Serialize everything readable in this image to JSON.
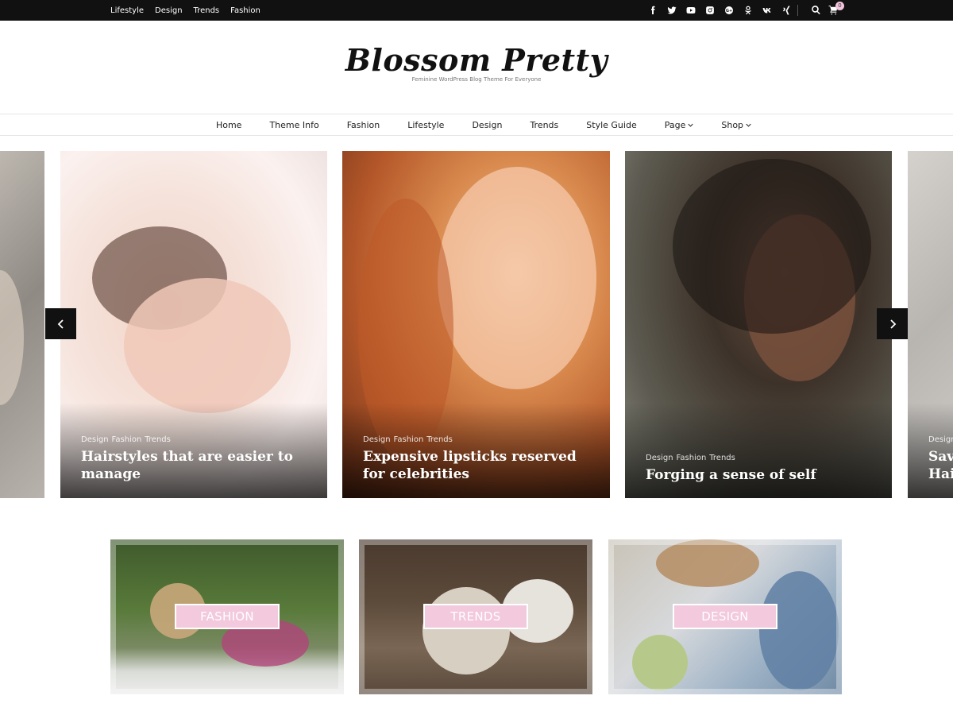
{
  "topbar": {
    "nav": [
      "Lifestyle",
      "Design",
      "Trends",
      "Fashion"
    ],
    "social_icons": [
      "facebook-icon",
      "twitter-icon",
      "youtube-icon",
      "instagram-icon",
      "google-plus-icon",
      "odnoklassniki-icon",
      "vk-icon",
      "xing-icon"
    ],
    "cart_count": "0"
  },
  "brand": {
    "title": "Blossom Pretty",
    "tagline": "Feminine WordPress Blog Theme For Everyone"
  },
  "mainnav": {
    "items": [
      {
        "label": "Home"
      },
      {
        "label": "Theme Info"
      },
      {
        "label": "Fashion"
      },
      {
        "label": "Lifestyle"
      },
      {
        "label": "Design"
      },
      {
        "label": "Trends"
      },
      {
        "label": "Style Guide"
      },
      {
        "label": "Page"
      },
      {
        "label": "Shop"
      }
    ]
  },
  "slider": {
    "slides": [
      {
        "categories": [
          "Design",
          "Fashion",
          "Trends"
        ],
        "title": "Hairstyles that are easier to manage"
      },
      {
        "categories": [
          "Design",
          "Fashion",
          "Trends"
        ],
        "title": "Expensive lipsticks reserved for celebrities"
      },
      {
        "categories": [
          "Design",
          "Fashion",
          "Trends"
        ],
        "title": "Forging a sense of self"
      }
    ],
    "edge_right": {
      "category": "Design",
      "title_line1": "Save",
      "title_line2": "Hair"
    }
  },
  "categories": [
    {
      "label": "FASHION"
    },
    {
      "label": "TRENDS"
    },
    {
      "label": "DESIGN"
    }
  ],
  "colors": {
    "topbar_bg": "#111111",
    "accent_pink": "#f2c9dd"
  }
}
